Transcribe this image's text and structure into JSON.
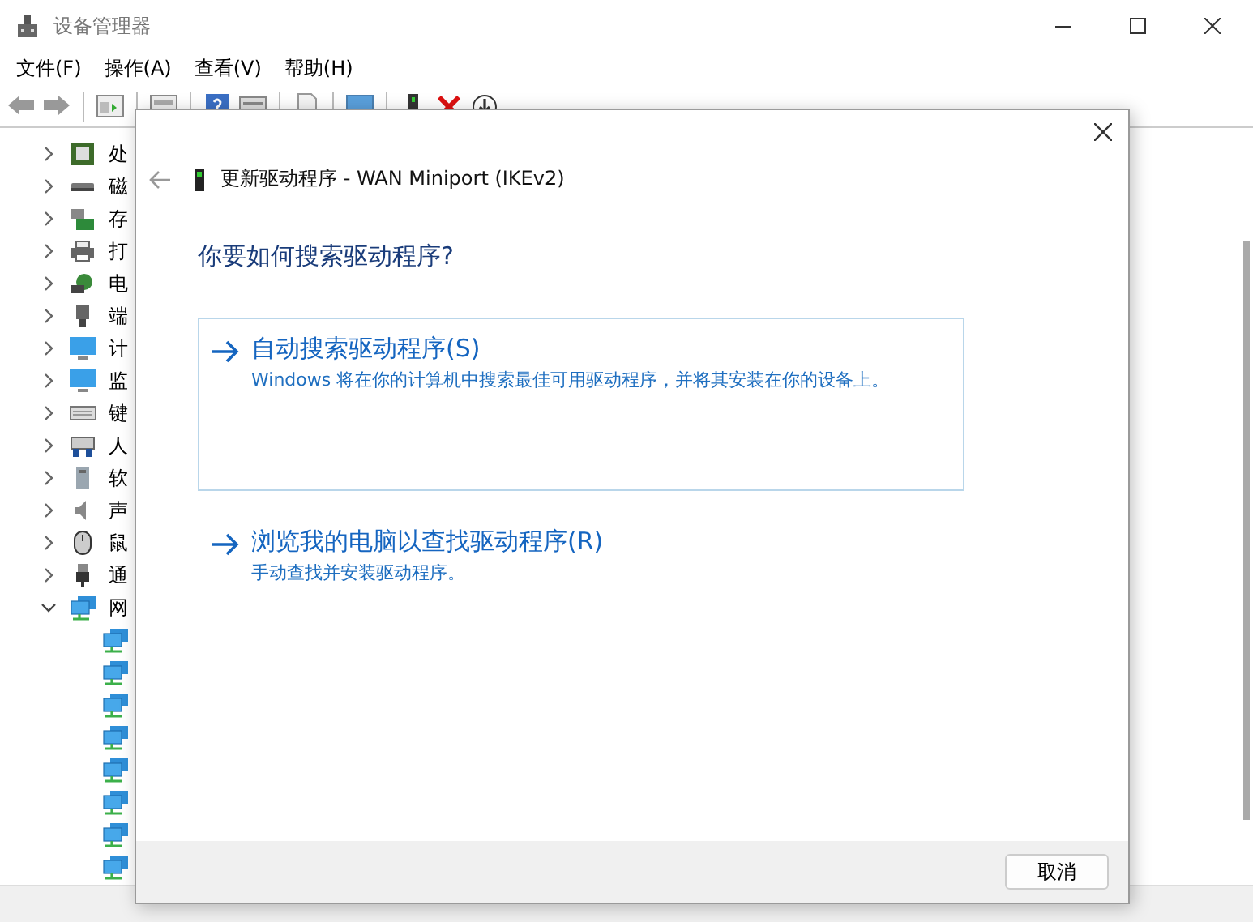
{
  "window": {
    "title": "设备管理器"
  },
  "menu": [
    "文件(F)",
    "操作(A)",
    "查看(V)",
    "帮助(H)"
  ],
  "tree": [
    {
      "label": "处",
      "expanded": false
    },
    {
      "label": "磁",
      "expanded": false
    },
    {
      "label": "存",
      "expanded": false
    },
    {
      "label": "打",
      "expanded": false
    },
    {
      "label": "电",
      "expanded": false
    },
    {
      "label": "端",
      "expanded": false
    },
    {
      "label": "计",
      "expanded": false
    },
    {
      "label": "监",
      "expanded": false
    },
    {
      "label": "键",
      "expanded": false
    },
    {
      "label": "人",
      "expanded": false
    },
    {
      "label": "软",
      "expanded": false
    },
    {
      "label": "声",
      "expanded": false
    },
    {
      "label": "鼠",
      "expanded": false
    },
    {
      "label": "通",
      "expanded": false
    },
    {
      "label": "网",
      "expanded": true,
      "children": [
        {
          "kind": "adapter"
        },
        {
          "kind": "adapter"
        },
        {
          "kind": "adapter"
        },
        {
          "kind": "adapter"
        },
        {
          "kind": "adapter"
        },
        {
          "kind": "adapter"
        },
        {
          "kind": "adapter"
        },
        {
          "kind": "adapter"
        }
      ]
    }
  ],
  "dialog": {
    "title": "更新驱动程序 - WAN Miniport (IKEv2)",
    "heading": "你要如何搜索驱动程序?",
    "options": [
      {
        "title": "自动搜索驱动程序(S)",
        "description": "Windows 将在你的计算机中搜索最佳可用驱动程序，并将其安装在你的设备上。",
        "selected": true
      },
      {
        "title": "浏览我的电脑以查找驱动程序(R)",
        "description": "手动查找并安装驱动程序。",
        "selected": false
      }
    ],
    "buttons": [
      "取消"
    ]
  }
}
